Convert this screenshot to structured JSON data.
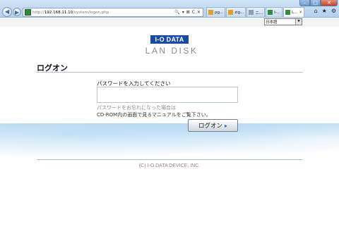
{
  "browser": {
    "url_prefix": "http://",
    "url_host": "192.168.11.10",
    "url_path": "/system/logon.php",
    "address_icons": [
      "🔍",
      "▾",
      "⊠",
      "C",
      "✕"
    ],
    "tabs": [
      {
        "label": "pg...",
        "icon": "page-icon",
        "color": "#e0a020",
        "active": false
      },
      {
        "label": "zig...",
        "icon": "page-icon",
        "color": "#e0a020",
        "active": false
      },
      {
        "label": "ニ...",
        "icon": "page-icon",
        "color": "#8aa0b8",
        "active": false
      },
      {
        "label": "I-...",
        "icon": "page-icon",
        "color": "#2e8b3a",
        "active": false
      },
      {
        "label": "L...",
        "icon": "page-icon",
        "color": "#2e8b3a",
        "active": true
      }
    ],
    "toolbar_icons": [
      "⌂",
      "★",
      "⚙"
    ]
  },
  "language": {
    "selected": "日本語"
  },
  "logo": {
    "top": "I-O DATA",
    "bottom": "LAN DISK"
  },
  "page": {
    "title": "ログオン",
    "password_label": "パスワードを入力してください",
    "password_value": "",
    "forgot_line1": "パスワードをお忘れになった場合は",
    "forgot_line2": "CD-ROM内の画面で見るマニュアルをご覧下さい。",
    "logon_button": "ログオン",
    "logon_chevron": "▸",
    "copyright": "(C) I-O DATA DEVICE, INC."
  },
  "colors": {
    "brand_blue": "#1a4aa5",
    "rule": "#a9c4de"
  }
}
